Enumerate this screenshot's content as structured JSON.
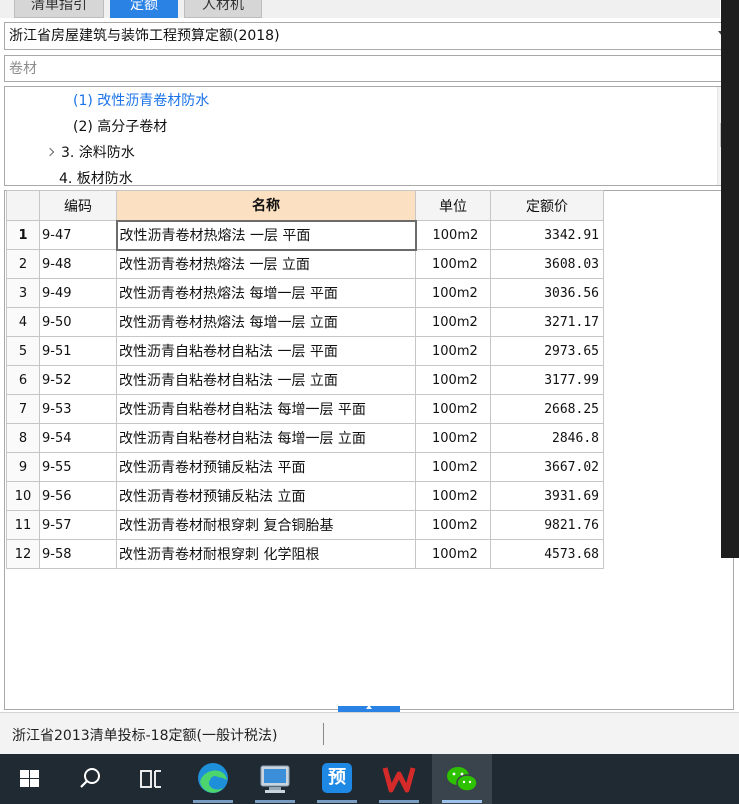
{
  "tabs": [
    {
      "label": "清单指引",
      "active": false
    },
    {
      "label": "定额",
      "active": true
    },
    {
      "label": "人材机",
      "active": false
    }
  ],
  "quota_library": {
    "selected": "浙江省房屋建筑与装饰工程预算定额(2018)"
  },
  "search": {
    "value": "",
    "placeholder": "卷材"
  },
  "tree": {
    "items": [
      {
        "label": "(1) 改性沥青卷材防水",
        "selected": true
      },
      {
        "label": "(2) 高分子卷材",
        "selected": false
      },
      {
        "label": "3. 涂料防水",
        "selected": false,
        "expandable": true
      },
      {
        "label": "4. 板材防水",
        "selected": false
      }
    ]
  },
  "table": {
    "columns": [
      "",
      "编码",
      "名称",
      "单位",
      "定额价"
    ],
    "current_row": 1,
    "rows": [
      {
        "num": "1",
        "code": "9-47",
        "name": "改性沥青卷材热熔法 一层 平面",
        "unit": "100m2",
        "price": "3342.91"
      },
      {
        "num": "2",
        "code": "9-48",
        "name": "改性沥青卷材热熔法 一层 立面",
        "unit": "100m2",
        "price": "3608.03"
      },
      {
        "num": "3",
        "code": "9-49",
        "name": "改性沥青卷材热熔法 每增一层 平面",
        "unit": "100m2",
        "price": "3036.56"
      },
      {
        "num": "4",
        "code": "9-50",
        "name": "改性沥青卷材热熔法 每增一层 立面",
        "unit": "100m2",
        "price": "3271.17"
      },
      {
        "num": "5",
        "code": "9-51",
        "name": "改性沥青自粘卷材自粘法 一层 平面",
        "unit": "100m2",
        "price": "2973.65"
      },
      {
        "num": "6",
        "code": "9-52",
        "name": "改性沥青自粘卷材自粘法 一层 立面",
        "unit": "100m2",
        "price": "3177.99"
      },
      {
        "num": "7",
        "code": "9-53",
        "name": "改性沥青自粘卷材自粘法 每增一层 平面",
        "unit": "100m2",
        "price": "2668.25"
      },
      {
        "num": "8",
        "code": "9-54",
        "name": "改性沥青自粘卷材自粘法 每增一层 立面",
        "unit": "100m2",
        "price": "2846.8"
      },
      {
        "num": "9",
        "code": "9-55",
        "name": "改性沥青卷材预铺反粘法 平面",
        "unit": "100m2",
        "price": "3667.02"
      },
      {
        "num": "10",
        "code": "9-56",
        "name": "改性沥青卷材预铺反粘法 立面",
        "unit": "100m2",
        "price": "3931.69"
      },
      {
        "num": "11",
        "code": "9-57",
        "name": "改性沥青卷材耐根穿刺 复合铜胎基",
        "unit": "100m2",
        "price": "9821.76"
      },
      {
        "num": "12",
        "code": "9-58",
        "name": "改性沥青卷材耐根穿刺 化学阻根",
        "unit": "100m2",
        "price": "4573.68"
      }
    ]
  },
  "status_bar": {
    "text": "浙江省2013清单投标-18定额(一般计税法)"
  },
  "taskbar": {
    "items": [
      {
        "icon": "windows-start-icon",
        "active": false
      },
      {
        "icon": "search-icon",
        "active": false
      },
      {
        "icon": "task-view-icon",
        "active": false
      },
      {
        "icon": "edge-browser-icon",
        "active": false,
        "running": true
      },
      {
        "icon": "remote-desktop-icon",
        "active": false,
        "running": true
      },
      {
        "icon": "budget-app-icon",
        "label": "预",
        "active": false,
        "running": true
      },
      {
        "icon": "wps-office-icon",
        "active": false,
        "running": true
      },
      {
        "icon": "wechat-icon",
        "active": true,
        "running": true
      }
    ]
  },
  "colors": {
    "accent": "#2a82e4",
    "tree_selected": "#1a73e8",
    "name_header": "#fce0c2",
    "taskbar": "#202a33",
    "budget_tile": "#1e88e5",
    "wps_red": "#d42a2a",
    "wechat_green": "#2dc100"
  }
}
